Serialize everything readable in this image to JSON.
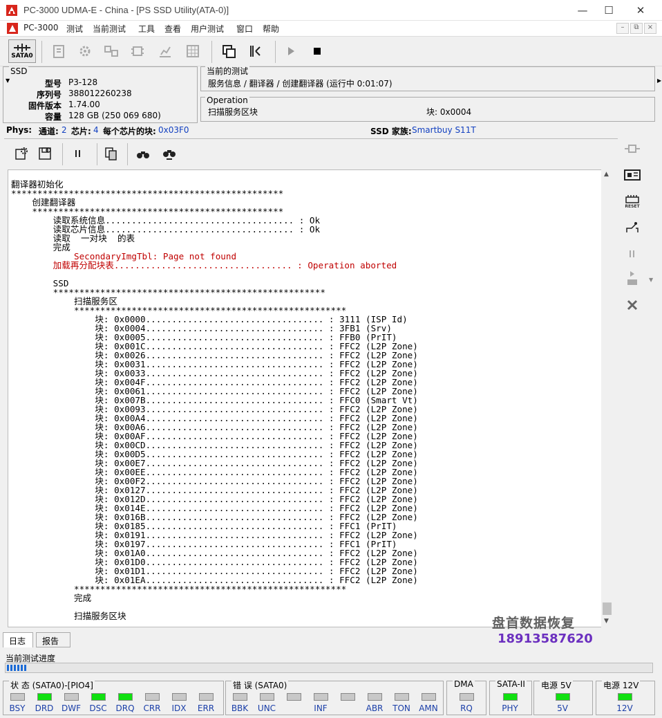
{
  "window": {
    "title": "PC-3000 UDMA-E - China - [PS SSD Utility(ATA-0)]"
  },
  "menu": {
    "items": [
      "PC-3000",
      "测试",
      "当前测试",
      "工具",
      "查看",
      "用户测试",
      "窗口",
      "帮助"
    ]
  },
  "toolbar": {
    "sata_label": "SATA0"
  },
  "ssd": {
    "group_label": "SSD",
    "rows": [
      {
        "key": "型号",
        "value": "P3-128"
      },
      {
        "key": "序列号",
        "value": "388012260238"
      },
      {
        "key": "固件版本",
        "value": "1.74.00"
      },
      {
        "key": "容量",
        "value": "128 GB (250 069 680)"
      }
    ]
  },
  "current_test": {
    "label": "当前的测试",
    "value": "服务信息 / 翻译器 / 创建翻译器 (运行中 0:01:07)"
  },
  "operation": {
    "label": "Operation",
    "value": "扫描服务区块",
    "block_label": "块: 0x0004"
  },
  "phys": {
    "label": "Phys:",
    "channels_label": "通道:",
    "channels": "2",
    "chips_label": "芯片:",
    "chips": "4",
    "blocks_label": "每个芯片的块:",
    "blocks": "0x03F0",
    "family_label": "SSD 家族:",
    "family": "Smartbuy S11T"
  },
  "log": {
    "lines": [
      {
        "t": "翻译器初始化",
        "c": ""
      },
      {
        "t": "****************************************************",
        "c": ""
      },
      {
        "t": "    创建翻译器",
        "c": ""
      },
      {
        "t": "    ************************************************",
        "c": ""
      },
      {
        "t": "        读取系统信息.................................... : Ok",
        "c": ""
      },
      {
        "t": "        读取芯片信息.................................... : Ok",
        "c": ""
      },
      {
        "t": "        读取  一对块  的表",
        "c": ""
      },
      {
        "t": "        完成",
        "c": ""
      },
      {
        "t": "            SecondaryImgTbl: Page not found",
        "c": "red"
      },
      {
        "t": "        加载再分配块表.................................. : Operation aborted",
        "c": "red"
      },
      {
        "t": "",
        "c": ""
      },
      {
        "t": "        SSD",
        "c": ""
      },
      {
        "t": "        ****************************************************",
        "c": ""
      },
      {
        "t": "            扫描服务区",
        "c": ""
      },
      {
        "t": "            ****************************************************",
        "c": ""
      },
      {
        "t": "                块: 0x0000.................................. : 3111 (ISP Id)",
        "c": ""
      },
      {
        "t": "                块: 0x0004.................................. : 3FB1 (Srv)",
        "c": ""
      },
      {
        "t": "                块: 0x0005.................................. : FFB0 (PrIT)",
        "c": ""
      },
      {
        "t": "                块: 0x001C.................................. : FFC2 (L2P Zone)",
        "c": ""
      },
      {
        "t": "                块: 0x0026.................................. : FFC2 (L2P Zone)",
        "c": ""
      },
      {
        "t": "                块: 0x0031.................................. : FFC2 (L2P Zone)",
        "c": ""
      },
      {
        "t": "                块: 0x0033.................................. : FFC2 (L2P Zone)",
        "c": ""
      },
      {
        "t": "                块: 0x004F.................................. : FFC2 (L2P Zone)",
        "c": ""
      },
      {
        "t": "                块: 0x0061.................................. : FFC2 (L2P Zone)",
        "c": ""
      },
      {
        "t": "                块: 0x007B.................................. : FFC0 (Smart Vt)",
        "c": ""
      },
      {
        "t": "                块: 0x0093.................................. : FFC2 (L2P Zone)",
        "c": ""
      },
      {
        "t": "                块: 0x00A4.................................. : FFC2 (L2P Zone)",
        "c": ""
      },
      {
        "t": "                块: 0x00A6.................................. : FFC2 (L2P Zone)",
        "c": ""
      },
      {
        "t": "                块: 0x00AF.................................. : FFC2 (L2P Zone)",
        "c": ""
      },
      {
        "t": "                块: 0x00CD.................................. : FFC2 (L2P Zone)",
        "c": ""
      },
      {
        "t": "                块: 0x00D5.................................. : FFC2 (L2P Zone)",
        "c": ""
      },
      {
        "t": "                块: 0x00E7.................................. : FFC2 (L2P Zone)",
        "c": ""
      },
      {
        "t": "                块: 0x00EE.................................. : FFC2 (L2P Zone)",
        "c": ""
      },
      {
        "t": "                块: 0x00F2.................................. : FFC2 (L2P Zone)",
        "c": ""
      },
      {
        "t": "                块: 0x0127.................................. : FFC2 (L2P Zone)",
        "c": ""
      },
      {
        "t": "                块: 0x012D.................................. : FFC2 (L2P Zone)",
        "c": ""
      },
      {
        "t": "                块: 0x014E.................................. : FFC2 (L2P Zone)",
        "c": ""
      },
      {
        "t": "                块: 0x016B.................................. : FFC2 (L2P Zone)",
        "c": ""
      },
      {
        "t": "                块: 0x0185.................................. : FFC1 (PrIT)",
        "c": ""
      },
      {
        "t": "                块: 0x0191.................................. : FFC2 (L2P Zone)",
        "c": ""
      },
      {
        "t": "                块: 0x0197.................................. : FFC1 (PrIT)",
        "c": ""
      },
      {
        "t": "                块: 0x01A0.................................. : FFC2 (L2P Zone)",
        "c": ""
      },
      {
        "t": "                块: 0x01D0.................................. : FFC2 (L2P Zone)",
        "c": ""
      },
      {
        "t": "                块: 0x01D1.................................. : FFC2 (L2P Zone)",
        "c": ""
      },
      {
        "t": "                块: 0x01EA.................................. : FFC2 (L2P Zone)",
        "c": ""
      },
      {
        "t": "            ****************************************************",
        "c": ""
      },
      {
        "t": "            完成",
        "c": ""
      },
      {
        "t": "",
        "c": ""
      },
      {
        "t": "            扫描服务区块",
        "c": ""
      }
    ]
  },
  "watermark": {
    "line1": "盘首数据恢复",
    "line2": "18913587620"
  },
  "tabs": {
    "log": "日志",
    "report": "报告"
  },
  "progress": {
    "label": "当前测试进度",
    "fraction": 0.03
  },
  "status": {
    "state_group": "状 态 (SATA0)-[PIO4]",
    "state_leds": [
      {
        "name": "BSY",
        "on": false
      },
      {
        "name": "DRD",
        "on": true
      },
      {
        "name": "DWF",
        "on": false
      },
      {
        "name": "DSC",
        "on": true
      },
      {
        "name": "DRQ",
        "on": true
      },
      {
        "name": "CRR",
        "on": false
      },
      {
        "name": "IDX",
        "on": false
      },
      {
        "name": "ERR",
        "on": false
      }
    ],
    "error_group": "错 误 (SATA0)",
    "error_leds": [
      {
        "name": "BBK",
        "on": false
      },
      {
        "name": "UNC",
        "on": false
      },
      {
        "name": "",
        "on": false
      },
      {
        "name": "INF",
        "on": false
      },
      {
        "name": "",
        "on": false
      },
      {
        "name": "ABR",
        "on": false
      },
      {
        "name": "TON",
        "on": false
      },
      {
        "name": "AMN",
        "on": false
      }
    ],
    "dma_group": "DMA",
    "dma_led": {
      "name": "RQ",
      "on": false
    },
    "sata_group": "SATA-II",
    "sata_led": {
      "name": "PHY",
      "on": true
    },
    "power5_group": "电源 5V",
    "power5_led": {
      "name": "5V",
      "on": true
    },
    "power12_group": "电源 12V",
    "power12_led": {
      "name": "12V",
      "on": true
    }
  },
  "colors": {
    "led_on": "#10e010",
    "led_off": "#c8c8c8",
    "blue_label": "#1a3ea8",
    "error_red": "#c00000"
  }
}
